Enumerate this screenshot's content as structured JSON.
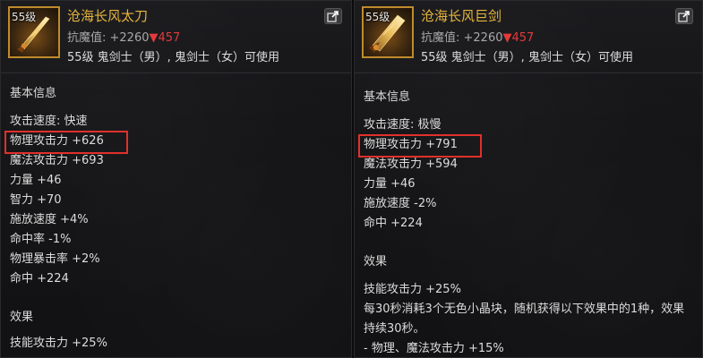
{
  "left": {
    "level_badge": "55级",
    "name": "沧海长风太刀",
    "resist_label": "抗魔值: +2260",
    "resist_down_arrow": "▼",
    "resist_down_value": "457",
    "requirement": "55级 鬼剑士（男）, 鬼剑士（女）可使用",
    "basic_info_title": "基本信息",
    "attributes": [
      "攻击速度: 快速",
      "物理攻击力 +626",
      "魔法攻击力 +693",
      "力量 +46",
      "智力 +70",
      "施放速度 +4%",
      "命中率 -1%",
      "物理暴击率 +2%",
      "命中 +224"
    ],
    "effect_title": "效果",
    "effects": [
      "技能攻击力 +25%"
    ]
  },
  "right": {
    "level_badge": "55级",
    "name": "沧海长风巨剑",
    "resist_label": "抗魔值: +2260",
    "resist_down_arrow": "▼",
    "resist_down_value": "457",
    "requirement": "55级 鬼剑士（男）, 鬼剑士（女）可使用",
    "basic_info_title": "基本信息",
    "attributes": [
      "攻击速度: 极慢",
      "物理攻击力 +791",
      "魔法攻击力 +594",
      "力量 +46",
      "施放速度 -2%",
      "命中 +224"
    ],
    "effect_title": "效果",
    "effects": [
      "技能攻击力 +25%",
      "每30秒消耗3个无色小晶块，随机获得以下效果中的1种，效果持续30秒。",
      "- 物理、魔法攻击力 +15%"
    ]
  },
  "colors": {
    "item_name": "#e6b43c",
    "resist_down": "#e23a3a",
    "highlight_box": "#e0302c",
    "icon_border": "#c08b2c"
  },
  "icons": {
    "share": "share-icon",
    "weapon": "sword-icon"
  }
}
